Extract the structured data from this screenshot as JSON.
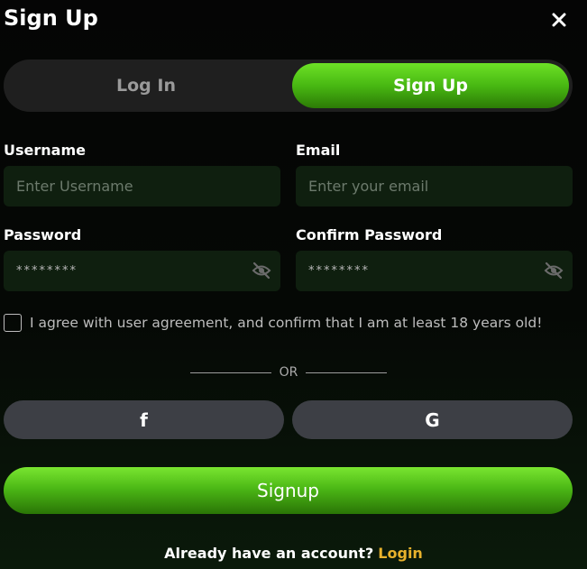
{
  "header": {
    "title": "Sign Up",
    "close_icon": "close-icon"
  },
  "tabs": [
    {
      "label": "Log In",
      "active": false
    },
    {
      "label": "Sign Up",
      "active": true
    }
  ],
  "form": {
    "username": {
      "label": "Username",
      "placeholder": "Enter Username",
      "value": ""
    },
    "email": {
      "label": "Email",
      "placeholder": "Enter your email",
      "value": ""
    },
    "password": {
      "label": "Password",
      "placeholder": "********",
      "icon": "eye-off-icon"
    },
    "confirm_password": {
      "label": "Confirm Password",
      "placeholder": "********",
      "icon": "eye-off-icon"
    },
    "agreement": {
      "text": "I agree with user agreement, and confirm that I am at least 18 years old!",
      "checked": false
    }
  },
  "divider": {
    "text": "OR"
  },
  "social": [
    {
      "name": "facebook",
      "icon": "facebook-icon",
      "glyph": "f"
    },
    {
      "name": "google",
      "icon": "google-icon",
      "glyph": "G"
    }
  ],
  "actions": {
    "submit_label": "Signup"
  },
  "footer": {
    "text": "Already have an account?",
    "link": "Login"
  },
  "colors": {
    "accent_green": "#4cb816",
    "link_gold": "#e8b22c",
    "input_bg": "#0f1f0f",
    "social_bg": "#3d3f45",
    "tab_bg": "#1f1f1f"
  }
}
